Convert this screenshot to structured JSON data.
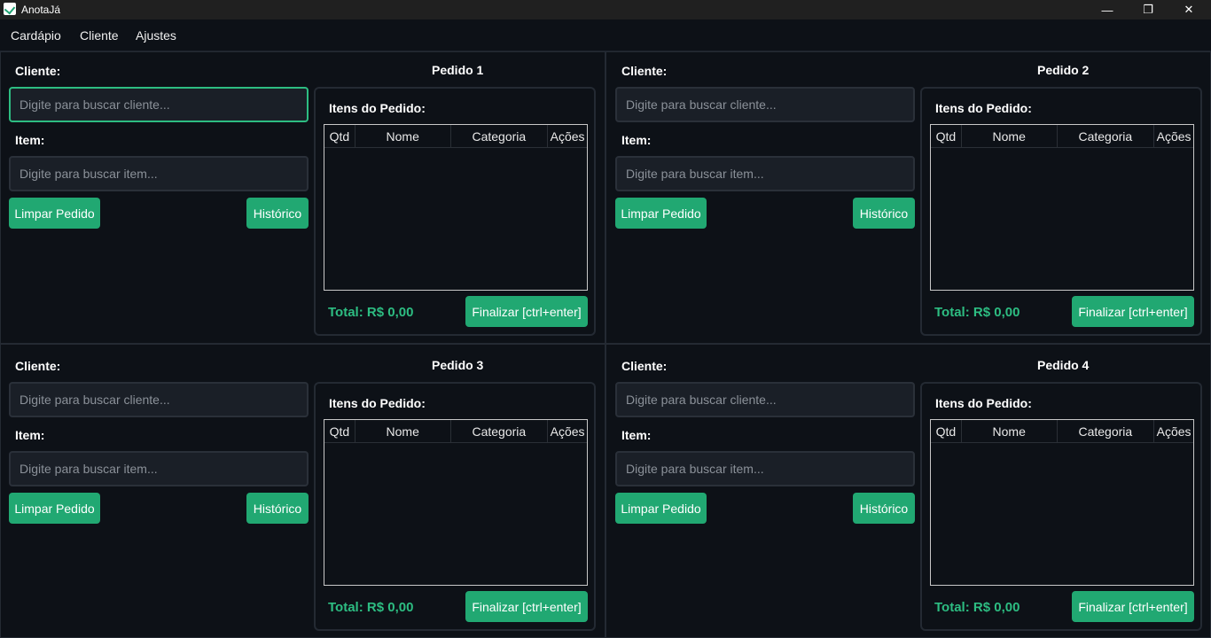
{
  "window": {
    "title": "AnotaJá",
    "minimize": "—",
    "maximize": "❐",
    "close": "✕"
  },
  "menu": {
    "items": [
      "Cardápio",
      "Cliente",
      "Ajustes"
    ]
  },
  "labels": {
    "cliente": "Cliente:",
    "item": "Item:",
    "itens_pedido": "Itens do Pedido:",
    "total": "Total: R$ 0,00"
  },
  "placeholders": {
    "cliente": "Digite para buscar cliente...",
    "item": "Digite para buscar item..."
  },
  "buttons": {
    "limpar": "Limpar Pedido",
    "historico": "Histórico",
    "finalizar": "Finalizar [ctrl+enter]"
  },
  "table_headers": [
    "Qtd",
    "Nome",
    "Categoria",
    "Ações"
  ],
  "orders": [
    {
      "title": "Pedido 1"
    },
    {
      "title": "Pedido 2"
    },
    {
      "title": "Pedido 3"
    },
    {
      "title": "Pedido 4"
    }
  ],
  "colors": {
    "accent": "#21a872",
    "total": "#2dbd82",
    "background": "#0d1117",
    "input": "#1a1f27"
  }
}
